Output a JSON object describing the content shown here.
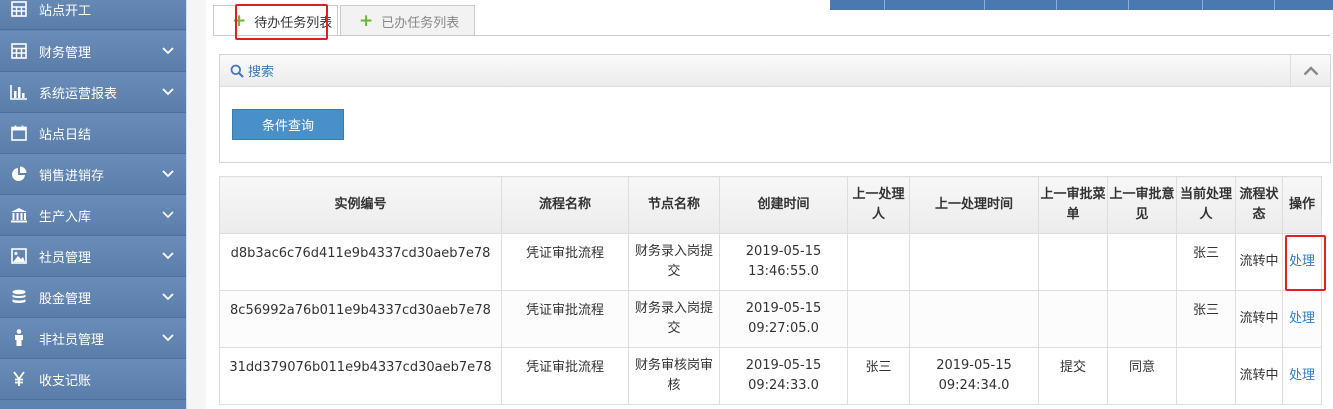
{
  "sidebar": {
    "items": [
      {
        "label": "站点开工",
        "icon": "calculator-icon",
        "has_children": false
      },
      {
        "label": "财务管理",
        "icon": "calculator-icon",
        "has_children": true
      },
      {
        "label": "系统运营报表",
        "icon": "bar-chart-icon",
        "has_children": true
      },
      {
        "label": "站点日结",
        "icon": "calendar-icon",
        "has_children": false
      },
      {
        "label": "销售进销存",
        "icon": "pie-chart-icon",
        "has_children": true
      },
      {
        "label": "生产入库",
        "icon": "bank-icon",
        "has_children": true
      },
      {
        "label": "社员管理",
        "icon": "image-icon",
        "has_children": true
      },
      {
        "label": "股金管理",
        "icon": "database-icon",
        "has_children": true
      },
      {
        "label": "非社员管理",
        "icon": "person-icon",
        "has_children": true
      },
      {
        "label": "收支记账",
        "icon": "yen-icon",
        "has_children": false
      }
    ]
  },
  "tabs": {
    "todo_label": "待办任务列表",
    "done_label": "已办任务列表"
  },
  "search": {
    "title": "搜索",
    "query_button": "条件查询"
  },
  "table": {
    "headers": [
      "实例编号",
      "流程名称",
      "节点名称",
      "创建时间",
      "上一处理人",
      "上一处理时间",
      "上一审批菜单",
      "上一审批意见",
      "当前处理人",
      "流程状态",
      "操作"
    ],
    "rows": [
      {
        "id": "d8b3ac6c76d411e9b4337cd30aeb7e78",
        "process": "凭证审批流程",
        "node": "财务录入岗提交",
        "created": "2019-05-15 13:46:55.0",
        "prev_handler": "",
        "prev_time": "",
        "prev_menu": "",
        "prev_opinion": "",
        "current": "张三",
        "status": "流转中",
        "action": "处理"
      },
      {
        "id": "8c56992a76b011e9b4337cd30aeb7e78",
        "process": "凭证审批流程",
        "node": "财务录入岗提交",
        "created": "2019-05-15 09:27:05.0",
        "prev_handler": "",
        "prev_time": "",
        "prev_menu": "",
        "prev_opinion": "",
        "current": "张三",
        "status": "流转中",
        "action": "处理"
      },
      {
        "id": "31dd379076b011e9b4337cd30aeb7e78",
        "process": "凭证审批流程",
        "node": "财务审核岗审核",
        "created": "2019-05-15 09:24:33.0",
        "prev_handler": "张三",
        "prev_time": "2019-05-15 09:24:34.0",
        "prev_menu": "提交",
        "prev_opinion": "同意",
        "current": "",
        "status": "流转中",
        "action": "处理"
      }
    ]
  },
  "colors": {
    "sidebar_bg": "#5f83b0",
    "accent": "#4a90c8",
    "link": "#2f7ec3",
    "highlight": "#e02020"
  }
}
